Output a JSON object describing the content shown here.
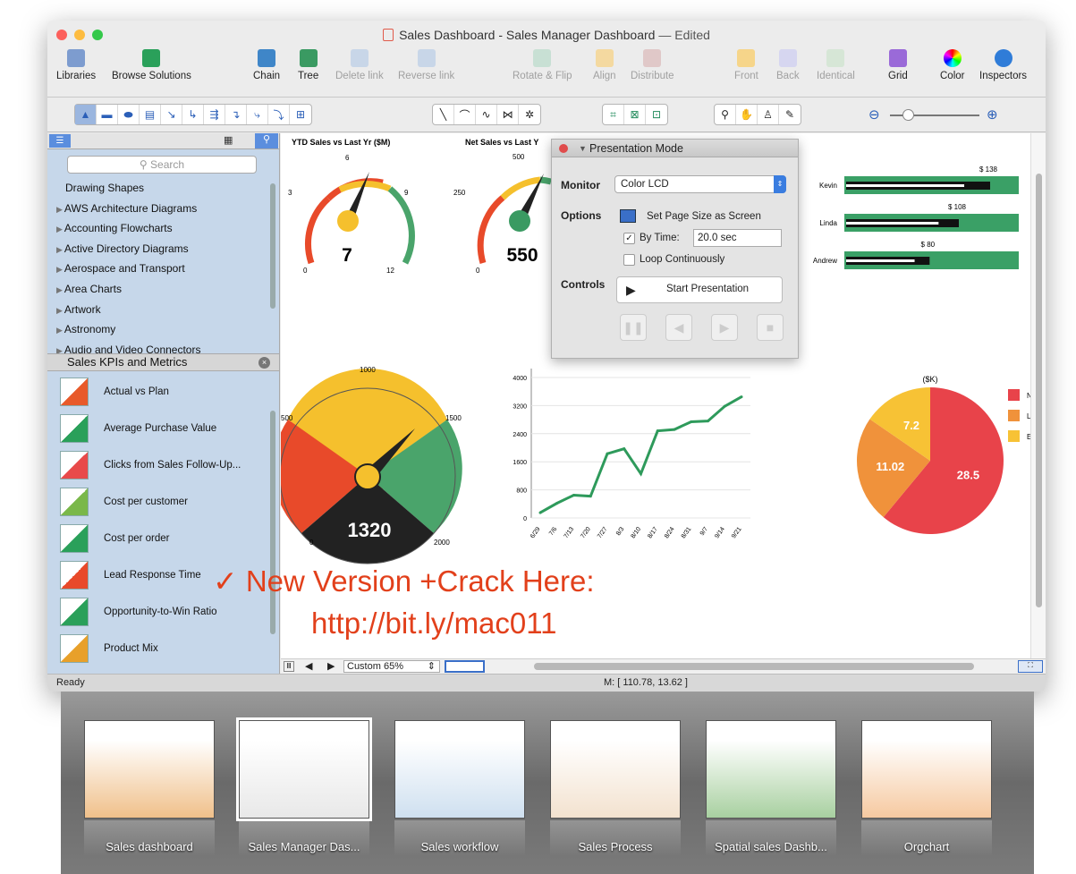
{
  "window": {
    "title": "Sales Dashboard - Sales Manager Dashboard",
    "edited": "— Edited"
  },
  "toolbar": {
    "items": [
      {
        "label": "Libraries",
        "icon": "libraries-icon",
        "enabled": true
      },
      {
        "label": "Browse Solutions",
        "icon": "browse-solutions-icon",
        "enabled": true
      },
      {
        "label": "Chain",
        "icon": "chain-icon",
        "enabled": true
      },
      {
        "label": "Tree",
        "icon": "tree-icon",
        "enabled": true
      },
      {
        "label": "Delete link",
        "icon": "delete-link-icon",
        "enabled": false
      },
      {
        "label": "Reverse link",
        "icon": "reverse-link-icon",
        "enabled": false
      },
      {
        "label": "Rotate & Flip",
        "icon": "rotate-flip-icon",
        "enabled": false
      },
      {
        "label": "Align",
        "icon": "align-icon",
        "enabled": false
      },
      {
        "label": "Distribute",
        "icon": "distribute-icon",
        "enabled": false
      },
      {
        "label": "Front",
        "icon": "front-icon",
        "enabled": false
      },
      {
        "label": "Back",
        "icon": "back-icon",
        "enabled": false
      },
      {
        "label": "Identical",
        "icon": "identical-icon",
        "enabled": false
      },
      {
        "label": "Grid",
        "icon": "grid-icon",
        "enabled": true
      },
      {
        "label": "Color",
        "icon": "color-icon",
        "enabled": true
      },
      {
        "label": "Inspectors",
        "icon": "inspectors-icon",
        "enabled": true
      }
    ]
  },
  "sidebar": {
    "search_placeholder": "Search",
    "libraries": [
      "Drawing Shapes",
      "AWS Architecture Diagrams",
      "Accounting Flowcharts",
      "Active Directory Diagrams",
      "Aerospace and Transport",
      "Area Charts",
      "Artwork",
      "Astronomy",
      "Audio and Video Connectors"
    ],
    "library_title": "Sales KPIs and Metrics",
    "kpis": [
      "Actual vs Plan",
      "Average Purchase Value",
      "Clicks from Sales Follow-Up...",
      "Cost per customer",
      "Cost per order",
      "Lead Response Time",
      "Opportunity-to-Win Ratio",
      "Product Mix"
    ]
  },
  "canvas": {
    "gauge1": {
      "title": "YTD Sales vs Last Yr ($M)",
      "value": "7",
      "ticks": [
        "0",
        "3",
        "6",
        "9",
        "12"
      ]
    },
    "gauge2": {
      "title": "Net Sales vs Last Y",
      "value": "550",
      "ticks": [
        "0",
        "250",
        "500"
      ]
    },
    "gauge3": {
      "value": "1320",
      "ticks": [
        "0",
        "500",
        "1000",
        "1500",
        "2000"
      ]
    }
  },
  "presentation": {
    "title": "Presentation Mode",
    "monitor_label": "Monitor",
    "monitor_value": "Color LCD",
    "options_label": "Options",
    "set_page_size": "Set Page Size as Screen",
    "by_time_label": "By Time:",
    "by_time_value": "20.0 sec",
    "loop": "Loop Continuously",
    "controls_label": "Controls",
    "start": "Start Presentation"
  },
  "scrollbar": {
    "zoom": "Custom 65%"
  },
  "status": {
    "left": "Ready",
    "coords": "M: [ 110.78, 13.62 ]"
  },
  "promo": {
    "line1": "✓ New Version +Crack Here:",
    "line2": "http://bit.ly/mac011"
  },
  "dock": [
    {
      "label": "Sales dashboard"
    },
    {
      "label": "Sales Manager Das..."
    },
    {
      "label": "Sales workflow"
    },
    {
      "label": "Sales Process"
    },
    {
      "label": "Spatial sales Dashb..."
    },
    {
      "label": "Orgchart"
    }
  ],
  "chart_data": [
    {
      "type": "bar",
      "categories": [
        "Kevin",
        "Linda",
        "Andrew"
      ],
      "values": [
        138,
        108,
        80
      ],
      "data_labels": [
        "$ 138",
        "$ 108",
        "$ 80"
      ],
      "xlim": [
        0,
        150
      ]
    },
    {
      "type": "line",
      "x": [
        "6/29",
        "7/6",
        "7/13",
        "7/20",
        "7/27",
        "8/3",
        "8/10",
        "8/17",
        "8/24",
        "8/31",
        "9/7",
        "9/14",
        "9/21"
      ],
      "values": [
        150,
        420,
        650,
        620,
        1830,
        1970,
        1260,
        2480,
        2520,
        2740,
        2760,
        3180,
        3450
      ],
      "yticks": [
        0,
        800,
        1600,
        2400,
        3200,
        4000
      ],
      "ylim": [
        0,
        4000
      ],
      "colors": {
        "line": "#2e9a5b"
      }
    },
    {
      "type": "pie",
      "title": "($K)",
      "series": [
        {
          "name": "North Ameri",
          "value": 28.5,
          "color": "#e8434a"
        },
        {
          "name": "Latin Americ",
          "value": 11.02,
          "color": "#f0923b"
        },
        {
          "name": "Europe",
          "value": 7.2,
          "color": "#f7c235"
        }
      ],
      "labels": [
        "28.5",
        "11.02",
        "7.2"
      ]
    }
  ]
}
